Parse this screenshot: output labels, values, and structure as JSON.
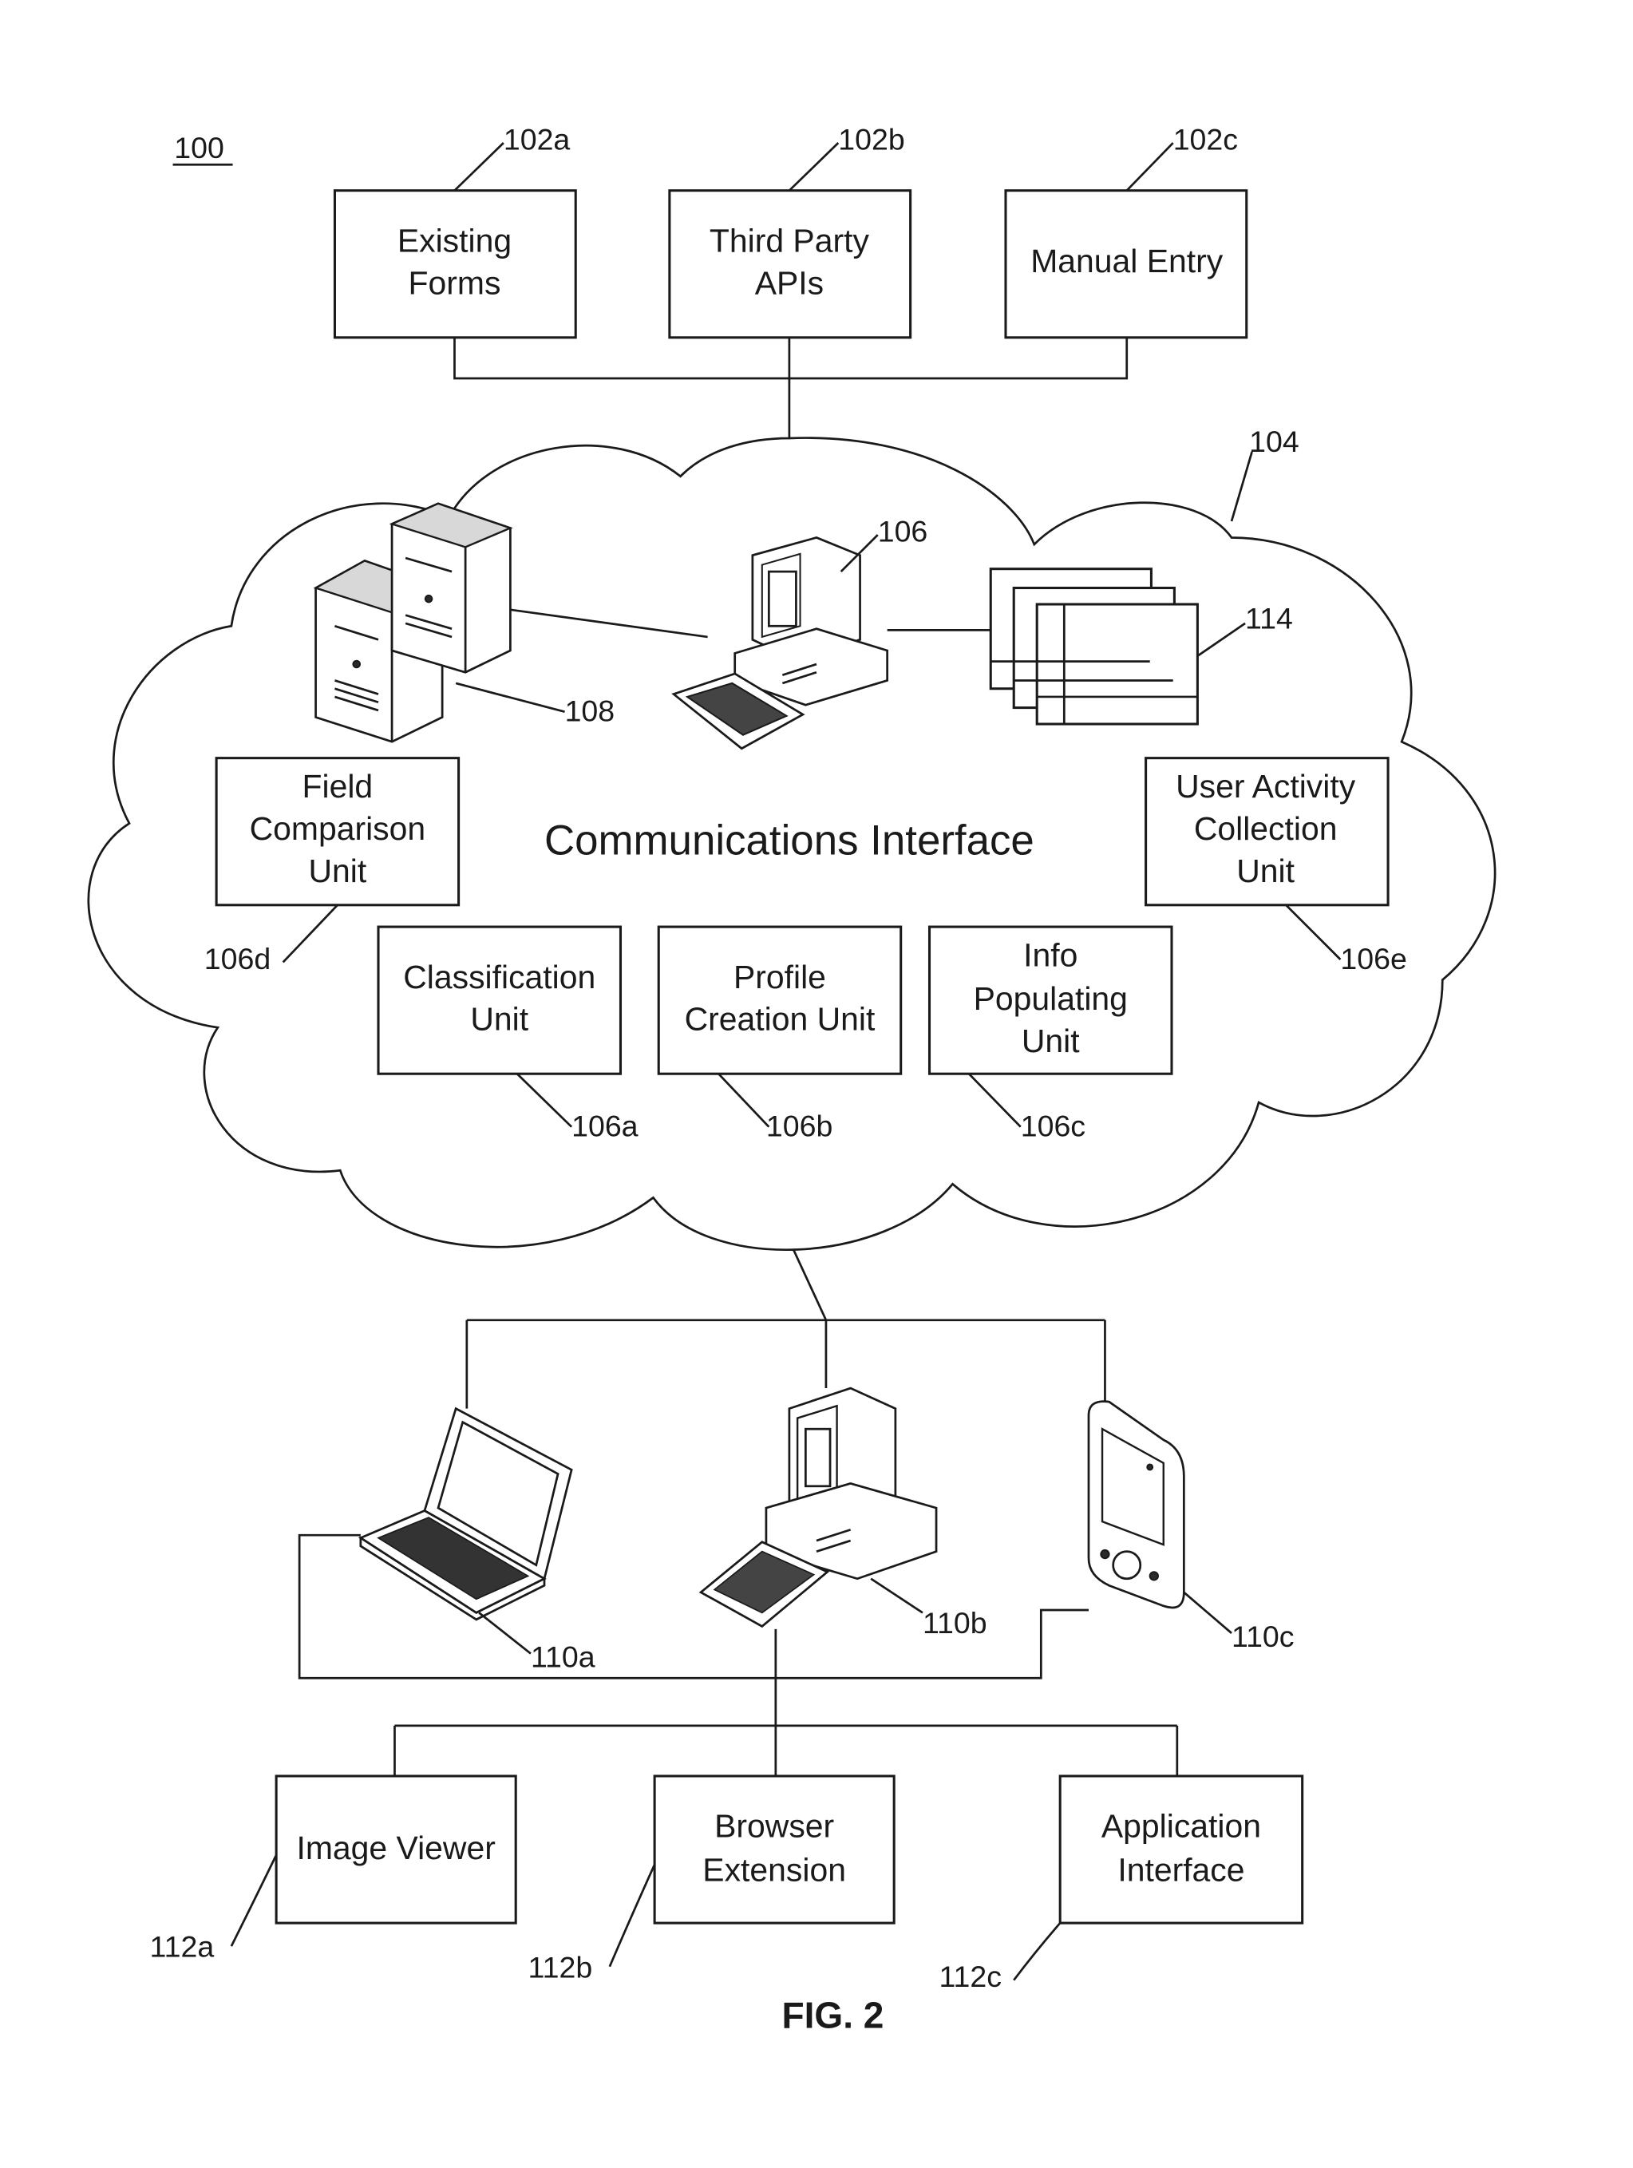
{
  "figure": {
    "system_ref": "100",
    "caption": "FIG. 2"
  },
  "sources": [
    {
      "ref": "102a",
      "lines": [
        "Existing",
        "Forms"
      ]
    },
    {
      "ref": "102b",
      "lines": [
        "Third Party",
        "APIs"
      ]
    },
    {
      "ref": "102c",
      "lines": [
        "Manual Entry"
      ]
    }
  ],
  "cloud": {
    "ref": "104",
    "title": "Communications Interface",
    "server_ref": "106",
    "database_server_ref": "108",
    "storage_ref": "114",
    "units": [
      {
        "ref": "106d",
        "lines": [
          "Field",
          "Comparison",
          "Unit"
        ]
      },
      {
        "ref": "106e",
        "lines": [
          "User Activity",
          "Collection",
          "Unit"
        ]
      },
      {
        "ref": "106a",
        "lines": [
          "Classification",
          "Unit"
        ]
      },
      {
        "ref": "106b",
        "lines": [
          "Profile",
          "Creation Unit"
        ]
      },
      {
        "ref": "106c",
        "lines": [
          "Info",
          "Populating",
          "Unit"
        ]
      }
    ]
  },
  "clients": [
    {
      "ref": "110a",
      "device": "laptop"
    },
    {
      "ref": "110b",
      "device": "desktop"
    },
    {
      "ref": "110c",
      "device": "handheld"
    }
  ],
  "interfaces": [
    {
      "ref": "112a",
      "lines": [
        "Image Viewer"
      ]
    },
    {
      "ref": "112b",
      "lines": [
        "Browser",
        "Extension"
      ]
    },
    {
      "ref": "112c",
      "lines": [
        "Application",
        "Interface"
      ]
    }
  ]
}
